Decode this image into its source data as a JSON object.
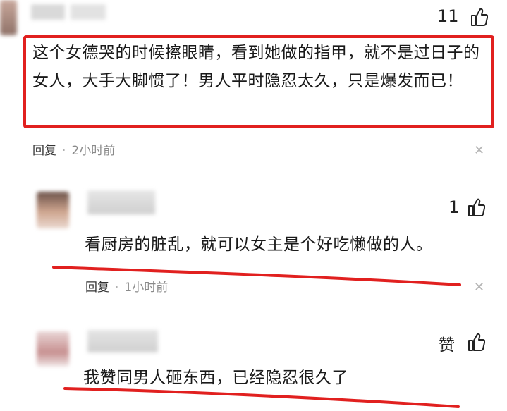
{
  "comments": [
    {
      "likes": "11",
      "text": "这个女德哭的时候擦眼睛，看到她做的指甲，就不是过日子的女人，大手大脚惯了！男人平时隐忍太久，只是爆发而已！",
      "reply_label": "回复",
      "time": "2小时前",
      "highlight_color": "#e1201f"
    },
    {
      "likes": "1",
      "text": "看厨房的脏乱，就可以女主是个好吃懒做的人。",
      "reply_label": "回复",
      "time": "1小时前",
      "underline_color": "#e1201f"
    },
    {
      "likes": "赞",
      "text": "我赞同男人砸东西，已经隐忍很久了",
      "underline_color": "#e1201f"
    }
  ],
  "icons": {
    "like": "thumbs-up-icon",
    "close": "close-icon"
  }
}
